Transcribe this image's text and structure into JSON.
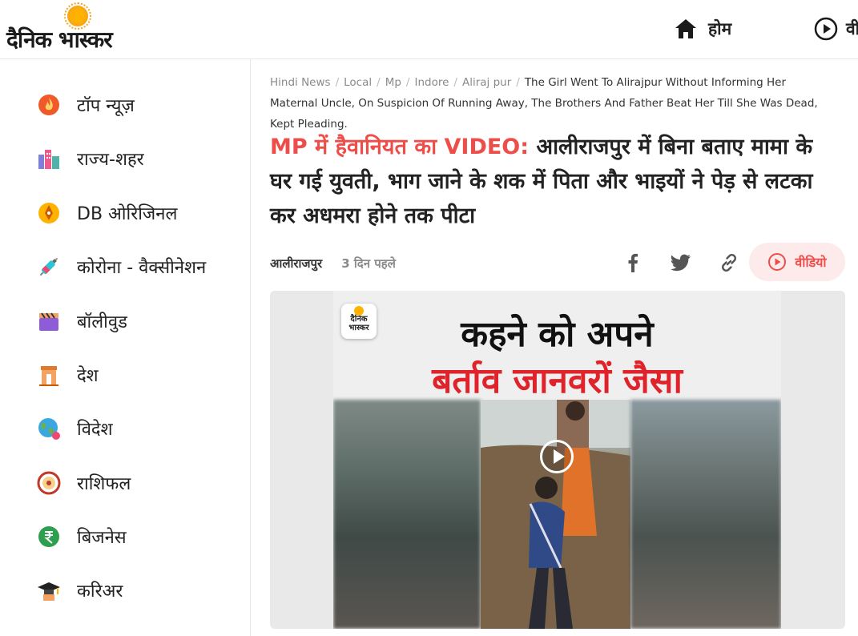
{
  "header": {
    "logo_text": "दैनिक भास्कर",
    "nav": [
      {
        "label": "होम",
        "icon": "home-icon"
      },
      {
        "label": "वी",
        "icon": "play-circle-icon"
      }
    ]
  },
  "sidebar": {
    "items": [
      {
        "label": "टॉप न्यूज़",
        "icon": "flame-icon"
      },
      {
        "label": "राज्य-शहर",
        "icon": "city-icon"
      },
      {
        "label": "DB ओरिजिनल",
        "icon": "pen-nib-icon"
      },
      {
        "label": "कोरोना - वैक्सीनेशन",
        "icon": "syringe-icon"
      },
      {
        "label": "बॉलीवुड",
        "icon": "clapperboard-icon"
      },
      {
        "label": "देश",
        "icon": "india-gate-icon"
      },
      {
        "label": "विदेश",
        "icon": "globe-icon"
      },
      {
        "label": "राशिफल",
        "icon": "zodiac-wheel-icon"
      },
      {
        "label": "बिजनेस",
        "icon": "rupee-icon"
      },
      {
        "label": "करिअर",
        "icon": "graduation-cap-icon"
      }
    ]
  },
  "breadcrumb": {
    "items": [
      "Hindi News",
      "Local",
      "Mp",
      "Indore",
      "Aliraj pur"
    ],
    "current": "The Girl Went To Alirajpur Without Informing Her Maternal Uncle, On Suspicion Of Running Away, The Brothers And Father Beat Her Till She Was Dead, Kept Pleading."
  },
  "article": {
    "headline_highlight": "MP में हैवानियत का VIDEO:",
    "headline_rest": " आलीराजपुर में बिना बताए मामा के घर गई युवती, भाग जाने के शक में पिता और भाइयों ने पेड़ से लटका कर अधमरा होने तक पीटा",
    "location": "आलीराजपुर",
    "time": "3 दिन पहले",
    "video_button": "वीडियो",
    "thumb_line1": "कहने को अपने",
    "thumb_line2": "बर्ताव जानवरों जैसा",
    "thumb_brand": "दैनिक भास्कर"
  },
  "colors": {
    "accent_red": "#ee4e4a",
    "brand_orange": "#f7a21b"
  }
}
